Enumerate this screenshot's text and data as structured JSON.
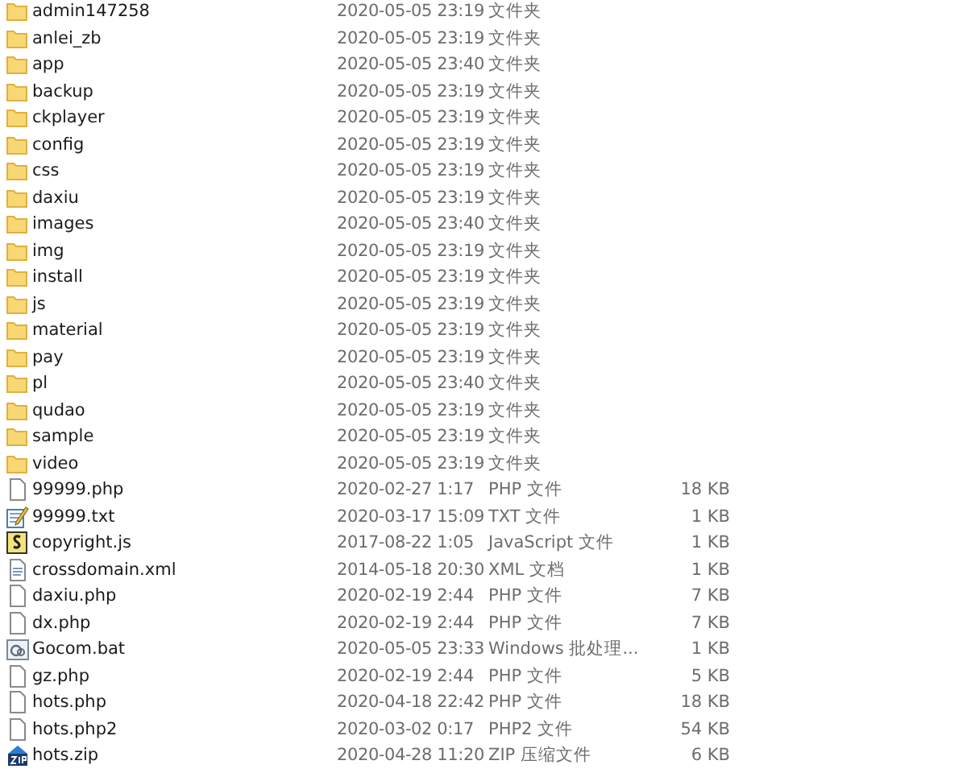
{
  "files": [
    {
      "kind": "folder",
      "name": "admin147258",
      "modified": "2020-05-05 23:19",
      "type": "文件夹"
    },
    {
      "kind": "folder",
      "name": "anlei_zb",
      "modified": "2020-05-05 23:19",
      "type": "文件夹"
    },
    {
      "kind": "folder",
      "name": "app",
      "modified": "2020-05-05 23:40",
      "type": "文件夹"
    },
    {
      "kind": "folder",
      "name": "backup",
      "modified": "2020-05-05 23:19",
      "type": "文件夹"
    },
    {
      "kind": "folder",
      "name": "ckplayer",
      "modified": "2020-05-05 23:19",
      "type": "文件夹"
    },
    {
      "kind": "folder",
      "name": "config",
      "modified": "2020-05-05 23:19",
      "type": "文件夹"
    },
    {
      "kind": "folder",
      "name": "css",
      "modified": "2020-05-05 23:19",
      "type": "文件夹"
    },
    {
      "kind": "folder",
      "name": "daxiu",
      "modified": "2020-05-05 23:19",
      "type": "文件夹"
    },
    {
      "kind": "folder",
      "name": "images",
      "modified": "2020-05-05 23:40",
      "type": "文件夹"
    },
    {
      "kind": "folder",
      "name": "img",
      "modified": "2020-05-05 23:19",
      "type": "文件夹"
    },
    {
      "kind": "folder",
      "name": "install",
      "modified": "2020-05-05 23:19",
      "type": "文件夹"
    },
    {
      "kind": "folder",
      "name": "js",
      "modified": "2020-05-05 23:19",
      "type": "文件夹"
    },
    {
      "kind": "folder",
      "name": "material",
      "modified": "2020-05-05 23:19",
      "type": "文件夹"
    },
    {
      "kind": "folder",
      "name": "pay",
      "modified": "2020-05-05 23:19",
      "type": "文件夹"
    },
    {
      "kind": "folder",
      "name": "pl",
      "modified": "2020-05-05 23:40",
      "type": "文件夹"
    },
    {
      "kind": "folder",
      "name": "qudao",
      "modified": "2020-05-05 23:19",
      "type": "文件夹"
    },
    {
      "kind": "folder",
      "name": "sample",
      "modified": "2020-05-05 23:19",
      "type": "文件夹"
    },
    {
      "kind": "folder",
      "name": "video",
      "modified": "2020-05-05 23:19",
      "type": "文件夹"
    },
    {
      "kind": "file",
      "name": "99999.php",
      "modified": "2020-02-27 1:17",
      "type": "PHP 文件",
      "size": "18 KB"
    },
    {
      "kind": "text",
      "name": "99999.txt",
      "modified": "2020-03-17 15:09",
      "type": "TXT 文件",
      "size": "1 KB"
    },
    {
      "kind": "script",
      "name": "copyright.js",
      "modified": "2017-08-22 1:05",
      "type": "JavaScript 文件",
      "size": "1 KB"
    },
    {
      "kind": "xml",
      "name": "crossdomain.xml",
      "modified": "2014-05-18 20:30",
      "type": "XML 文档",
      "size": "1 KB"
    },
    {
      "kind": "file",
      "name": "daxiu.php",
      "modified": "2020-02-19 2:44",
      "type": "PHP 文件",
      "size": "7 KB"
    },
    {
      "kind": "file",
      "name": "dx.php",
      "modified": "2020-02-19 2:44",
      "type": "PHP 文件",
      "size": "7 KB"
    },
    {
      "kind": "batch",
      "name": "Gocom.bat",
      "modified": "2020-05-05 23:33",
      "type": "Windows 批处理...",
      "size": "1 KB"
    },
    {
      "kind": "file",
      "name": "gz.php",
      "modified": "2020-02-19 2:44",
      "type": "PHP 文件",
      "size": "5 KB"
    },
    {
      "kind": "file",
      "name": "hots.php",
      "modified": "2020-04-18 22:42",
      "type": "PHP 文件",
      "size": "18 KB"
    },
    {
      "kind": "file",
      "name": "hots.php2",
      "modified": "2020-03-02 0:17",
      "type": "PHP2 文件",
      "size": "54 KB"
    },
    {
      "kind": "zip",
      "name": "hots.zip",
      "modified": "2020-04-28 11:20",
      "type": "ZIP 压缩文件",
      "size": "6 KB"
    }
  ]
}
